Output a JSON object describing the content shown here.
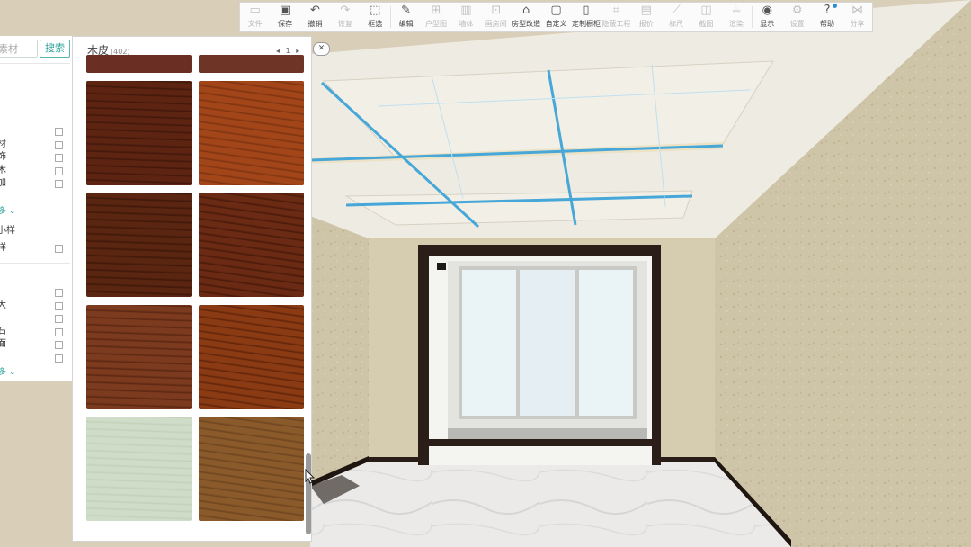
{
  "toolbar": {
    "items": [
      {
        "label": "文件",
        "icon": "file-icon",
        "enabled": false
      },
      {
        "label": "保存",
        "icon": "save-icon",
        "enabled": true
      },
      {
        "label": "撤销",
        "icon": "undo-icon",
        "enabled": true
      },
      {
        "label": "恢复",
        "icon": "redo-icon",
        "enabled": false
      },
      {
        "label": "框选",
        "icon": "box-select-icon",
        "enabled": true
      },
      {
        "label": "编辑",
        "icon": "edit-icon",
        "enabled": true
      },
      {
        "label": "户型图",
        "icon": "floorplan-icon",
        "enabled": false
      },
      {
        "label": "墙体",
        "icon": "wall-icon",
        "enabled": false
      },
      {
        "label": "画房间",
        "icon": "draw-room-icon",
        "enabled": false
      },
      {
        "label": "房型改造",
        "icon": "room-remodel-icon",
        "enabled": true
      },
      {
        "label": "自定义",
        "icon": "custom-icon",
        "enabled": true
      },
      {
        "label": "定制橱柜",
        "icon": "cabinet-icon",
        "enabled": true
      },
      {
        "label": "隐蔽工程",
        "icon": "hidden-works-icon",
        "enabled": false
      },
      {
        "label": "报价",
        "icon": "quote-icon",
        "enabled": false
      },
      {
        "label": "标尺",
        "icon": "ruler-icon",
        "enabled": false
      },
      {
        "label": "截图",
        "icon": "screenshot-icon",
        "enabled": false
      },
      {
        "label": "渲染",
        "icon": "render-icon",
        "enabled": false
      },
      {
        "label": "显示",
        "icon": "eye-icon",
        "enabled": true
      },
      {
        "label": "设置",
        "icon": "gear-icon",
        "enabled": false
      },
      {
        "label": "帮助",
        "icon": "help-icon",
        "enabled": true
      },
      {
        "label": "分享",
        "icon": "share-icon",
        "enabled": false
      }
    ]
  },
  "left_panel": {
    "search_placeholder": "素材",
    "search_button": "搜索",
    "rows_group1": [
      "",
      "材",
      "饰",
      "木",
      "加"
    ],
    "more1": "多 ⌄",
    "group2_title": "小样",
    "rows_group2": [
      "样"
    ],
    "rows_group3": [
      "",
      "大",
      "",
      "石",
      "面",
      ""
    ],
    "more2": "多 ⌄"
  },
  "material_panel": {
    "title": "木皮",
    "count": "(402)",
    "pager_prev": "◂",
    "page": "1",
    "pager_next": "▸",
    "close_label": "✕",
    "swatches": [
      {
        "color": "#6e2f1c",
        "grain": "#4d1f10"
      },
      {
        "color": "#7a3218",
        "grain": "#5a220e"
      },
      {
        "color": "#5e2412",
        "grain": "#3f170a"
      },
      {
        "color": "#a2461a",
        "grain": "#7d3210"
      },
      {
        "color": "#5a2511",
        "grain": "#3e1709"
      },
      {
        "color": "#6a2a13",
        "grain": "#48190a"
      },
      {
        "color": "#7c3a1e",
        "grain": "#5a2612"
      },
      {
        "color": "#8b3b13",
        "grain": "#5f230a"
      },
      {
        "color": "#cfdcc7",
        "grain": "#c3d1bb"
      },
      {
        "color": "#8a5a2a",
        "grain": "#6d4420"
      }
    ]
  },
  "colors": {
    "accent": "#2aa197",
    "ceiling_beam": "#46a7d8",
    "wall": "#cfc3a6",
    "frame": "#2b1d17"
  }
}
